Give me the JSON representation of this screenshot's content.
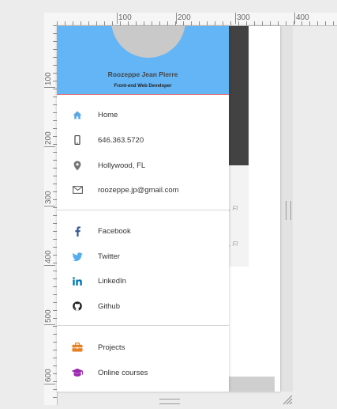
{
  "ruler": {
    "top_labels": [
      "100",
      "200",
      "300",
      "400"
    ],
    "left_labels": [
      "100",
      "200",
      "300",
      "400",
      "500",
      "600"
    ]
  },
  "profile": {
    "name": "Roozeppe Jean Pierre",
    "role": "Front-end Web Developer"
  },
  "contact_items": [
    {
      "icon": "home-icon",
      "label": "Home",
      "color": "#5aa9e6"
    },
    {
      "icon": "phone-icon",
      "label": "646.363.5720",
      "color": "#424242"
    },
    {
      "icon": "location-icon",
      "label": "Hollywood, FL",
      "color": "#757575"
    },
    {
      "icon": "mail-icon",
      "label": "roozeppe.jp@gmail.com",
      "color": "#616161"
    }
  ],
  "social_items": [
    {
      "icon": "facebook-icon",
      "label": "Facebook",
      "color": "#3b5998"
    },
    {
      "icon": "twitter-icon",
      "label": "Twitter",
      "color": "#55acee"
    },
    {
      "icon": "linkedin-icon",
      "label": "LinkedIn",
      "color": "#0077b5"
    },
    {
      "icon": "github-icon",
      "label": "Github",
      "color": "#222222"
    }
  ],
  "extra_items": [
    {
      "icon": "briefcase-icon",
      "label": "Projects",
      "color": "#e67e22"
    },
    {
      "icon": "graduation-cap-icon",
      "label": "Online courses",
      "color": "#9c27b0"
    }
  ],
  "background_page": {
    "snippet1": ", Fl",
    "snippet2": ", Fl"
  },
  "colors": {
    "header": "#64b5f6",
    "header_border": "#e57373"
  }
}
